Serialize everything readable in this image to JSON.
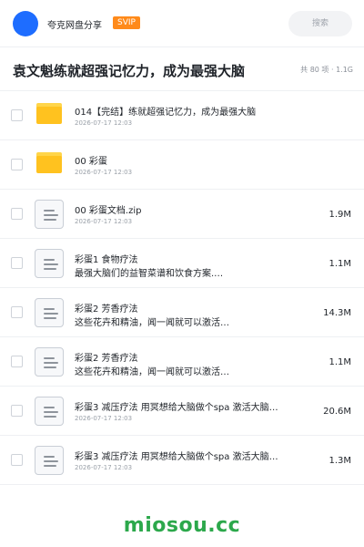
{
  "header": {
    "user_name": "夸克网盘分享",
    "badge": "SVIP",
    "search_placeholder": "搜索"
  },
  "title_bar": {
    "title": "袁文魁练就超强记忆力，成为最强大脑",
    "meta": "共 80 项 · 1.1G"
  },
  "items": [
    {
      "type": "folder",
      "name": "014【完结】练就超强记忆力，成为最强大脑",
      "sub": "2026-07-17 12:03",
      "size": ""
    },
    {
      "type": "folder",
      "name": "00 彩蛋",
      "sub": "2026-07-17 12:03",
      "size": ""
    },
    {
      "type": "file",
      "name": "00 彩蛋文档.zip",
      "sub": "2026-07-17 12:03",
      "size": "1.9M"
    },
    {
      "type": "file",
      "name": "彩蛋1 食物疗法",
      "sub": "最强大脑们的益智菜谱和饮食方案.…",
      "size": "1.1M"
    },
    {
      "type": "file",
      "name": "彩蛋2 芳香疗法",
      "sub": "这些花卉和精油，闻一闻就可以激活…",
      "size": "14.3M"
    },
    {
      "type": "file",
      "name": "彩蛋2 芳香疗法",
      "sub": "这些花卉和精油，闻一闻就可以激活…",
      "size": "1.1M"
    },
    {
      "type": "file",
      "name": "彩蛋3 减压疗法 用冥想给大脑做个spa 激活大脑…",
      "sub": "2026-07-17 12:03",
      "size": "20.6M"
    },
    {
      "type": "file",
      "name": "彩蛋3 减压疗法 用冥想给大脑做个spa 激活大脑…",
      "sub": "2026-07-17 12:03",
      "size": "1.3M"
    }
  ],
  "watermark": "miosou.cc",
  "colors": {
    "accent": "#1e6dff",
    "svip": "#ff8a1a",
    "folder": "#ffc21f",
    "watermark": "#2ca84b"
  }
}
